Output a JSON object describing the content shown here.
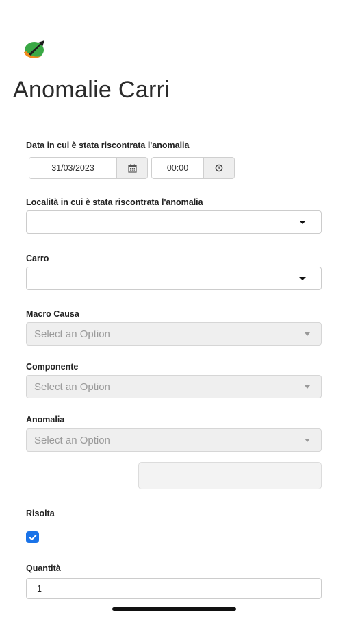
{
  "page": {
    "title": "Anomalie Carri"
  },
  "date_section": {
    "label": "Data in cui è stata riscontrata l'anomalia",
    "date_value": "31/03/2023",
    "time_value": "00:00"
  },
  "localita": {
    "label": "Località in cui è stata riscontrata l'anomalia",
    "value": ""
  },
  "carro": {
    "label": "Carro",
    "value": ""
  },
  "macro_causa": {
    "label": "Macro Causa",
    "placeholder": "Select an Option"
  },
  "componente": {
    "label": "Componente",
    "placeholder": "Select an Option"
  },
  "anomalia": {
    "label": "Anomalia",
    "placeholder": "Select an Option"
  },
  "risolta": {
    "label": "Risolta",
    "checked": true
  },
  "quantita": {
    "label": "Quantità",
    "value": "1"
  },
  "colors": {
    "accent": "#1a73e8",
    "logo_green": "#3aa845",
    "logo_orange": "#f08a1c"
  }
}
